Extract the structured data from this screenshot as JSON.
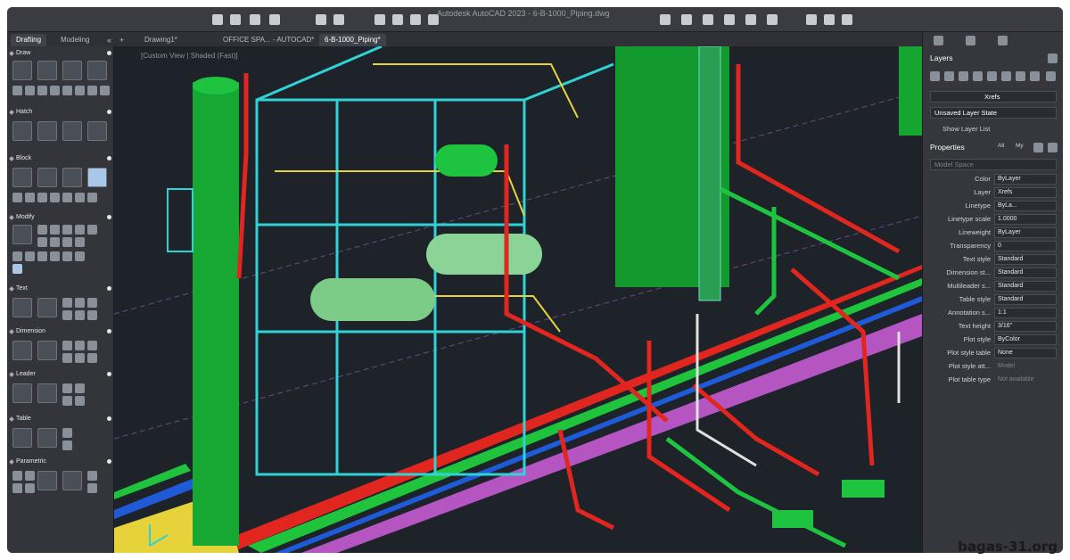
{
  "window": {
    "title": "Autodesk AutoCAD 2023 - 6-B-1000_Piping.dwg"
  },
  "tabs": [
    {
      "label": "Drawing1*"
    },
    {
      "label": "OFFICE SPA... - AUTOCAD*"
    },
    {
      "label": "6-B-1000_Piping*"
    }
  ],
  "palette_tabs": {
    "drafting": "Drafting",
    "modeling": "Modeling"
  },
  "sections": {
    "draw": "Draw",
    "hatch": "Hatch",
    "block": "Block",
    "modify": "Modify",
    "text": "Text",
    "dimension": "Dimension",
    "leader": "Leader",
    "table": "Table",
    "parametric": "Parametric"
  },
  "viewport": {
    "label": "[Custom View | Shaded (Fast)]"
  },
  "layers": {
    "title": "Layers",
    "current_layer": "Xrefs",
    "layer_state": "Unsaved Layer State",
    "show_list": "Show Layer List"
  },
  "properties": {
    "title": "Properties",
    "filter_all": "All",
    "filter_my": "My",
    "space": "Model Space",
    "rows": [
      {
        "name": "Color",
        "value": "ByLayer"
      },
      {
        "name": "Layer",
        "value": "Xrefs"
      },
      {
        "name": "Linetype",
        "value": "ByLa..."
      },
      {
        "name": "Linetype scale",
        "value": "1.0000"
      },
      {
        "name": "Lineweight",
        "value": "ByLayer"
      },
      {
        "name": "Transparency",
        "value": "0"
      },
      {
        "name": "Text style",
        "value": "Standard"
      },
      {
        "name": "Dimension st...",
        "value": "Standard"
      },
      {
        "name": "Multileader s...",
        "value": "Standard"
      },
      {
        "name": "Table style",
        "value": "Standard"
      },
      {
        "name": "Annotation s...",
        "value": "1:1"
      },
      {
        "name": "Text height",
        "value": "3/16\""
      },
      {
        "name": "Plot style",
        "value": "ByColor"
      },
      {
        "name": "Plot style table",
        "value": "None"
      },
      {
        "name": "Plot style att...",
        "value": "Model"
      },
      {
        "name": "Plot table type",
        "value": "Not available"
      }
    ]
  },
  "watermark": "bagas-31.org",
  "colors": {
    "pipe_green": "#18b53a",
    "pipe_red": "#e0261e",
    "steel_cyan": "#2fd3d6",
    "rail_yellow": "#e6d23a",
    "purple_main": "#b455c2"
  }
}
